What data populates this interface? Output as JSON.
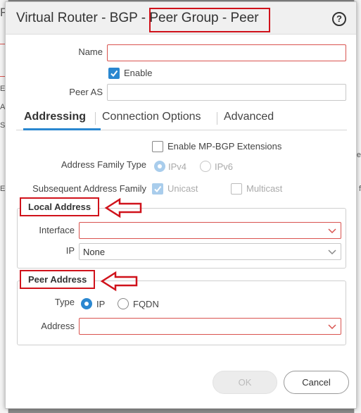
{
  "background": {
    "left_fragments": [
      "Ei",
      "Ag",
      "So",
      "EN"
    ],
    "right_fragments": [
      "F",
      "e",
      "f"
    ]
  },
  "dialog": {
    "title_prefix": "Virtual Router - BGP - ",
    "title_highlight": "Peer Group - Peer",
    "help_icon": "question-circle-icon"
  },
  "form": {
    "name_label": "Name",
    "name_value": "",
    "enable_label": "Enable",
    "enable_checked": true,
    "peer_as_label": "Peer AS",
    "peer_as_value": ""
  },
  "tabs": [
    {
      "label": "Addressing",
      "active": true
    },
    {
      "label": "Connection Options",
      "active": false
    },
    {
      "label": "Advanced",
      "active": false
    }
  ],
  "addressing": {
    "mpbgp_label": "Enable MP-BGP Extensions",
    "mpbgp_checked": false,
    "afi_label": "Address Family Type",
    "afi_options": [
      "IPv4",
      "IPv6"
    ],
    "afi_selected": "IPv4",
    "safi_label": "Subsequent Address Family",
    "safi_unicast": "Unicast",
    "safi_unicast_checked": true,
    "safi_multicast": "Multicast",
    "safi_multicast_checked": false
  },
  "local_address": {
    "title": "Local Address",
    "interface_label": "Interface",
    "interface_value": "",
    "ip_label": "IP",
    "ip_value": "None"
  },
  "peer_address": {
    "title": "Peer Address",
    "type_label": "Type",
    "type_options": [
      "IP",
      "FQDN"
    ],
    "type_selected": "IP",
    "address_label": "Address",
    "address_value": ""
  },
  "buttons": {
    "ok": "OK",
    "cancel": "Cancel"
  },
  "colors": {
    "accent": "#2a87d0",
    "required_border": "#d9534f",
    "annotation_red": "#d0121b"
  }
}
